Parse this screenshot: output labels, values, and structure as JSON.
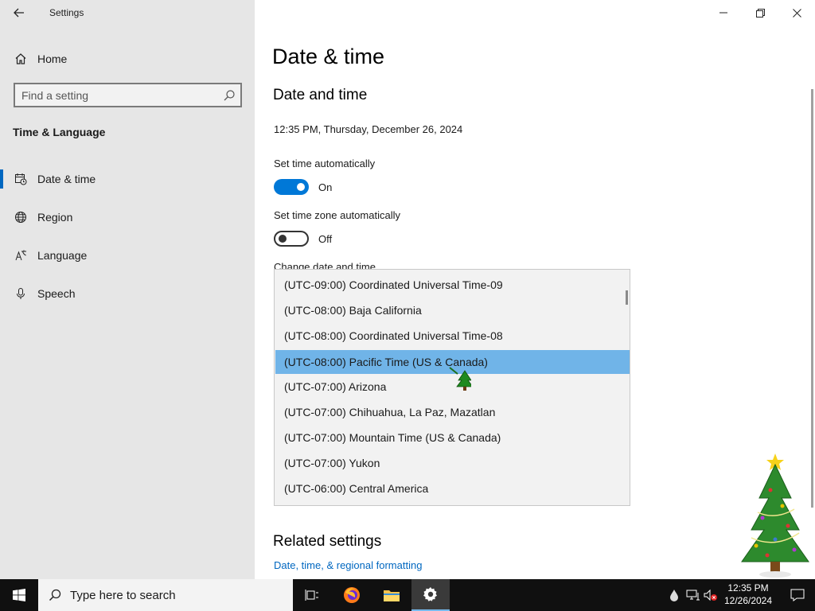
{
  "window": {
    "app_title": "Settings"
  },
  "sidebar": {
    "home_label": "Home",
    "search_placeholder": "Find a setting",
    "section_heading": "Time & Language",
    "items": [
      {
        "label": "Date & time",
        "icon": "calendar-clock-icon",
        "active": true
      },
      {
        "label": "Region",
        "icon": "globe-icon",
        "active": false
      },
      {
        "label": "Language",
        "icon": "language-icon",
        "active": false
      },
      {
        "label": "Speech",
        "icon": "microphone-icon",
        "active": false
      }
    ]
  },
  "main": {
    "page_title": "Date & time",
    "section_title": "Date and time",
    "current_datetime": "12:35 PM, Thursday, December 26, 2024",
    "set_time_auto": {
      "label": "Set time automatically",
      "state": "On",
      "on": true
    },
    "set_zone_auto": {
      "label": "Set time zone automatically",
      "state": "Off",
      "on": false
    },
    "change_label": "Change date and time",
    "timezone_options": [
      "(UTC-09:00) Coordinated Universal Time-09",
      "(UTC-08:00) Baja California",
      "(UTC-08:00) Coordinated Universal Time-08",
      "(UTC-08:00) Pacific Time (US & Canada)",
      "(UTC-07:00) Arizona",
      "(UTC-07:00) Chihuahua, La Paz, Mazatlan",
      "(UTC-07:00) Mountain Time (US & Canada)",
      "(UTC-07:00) Yukon",
      "(UTC-06:00) Central America"
    ],
    "selected_timezone_index": 3,
    "related_title": "Related settings",
    "related_link": "Date, time, & regional formatting"
  },
  "taskbar": {
    "search_placeholder": "Type here to search",
    "apps": [
      "task-view-icon",
      "firefox-icon",
      "file-explorer-icon",
      "settings-icon"
    ],
    "active_app": "settings-icon",
    "clock_time": "12:35 PM",
    "clock_date": "12/26/2024"
  },
  "colors": {
    "accent": "#0078d7",
    "selection": "#70b4e8",
    "sidebar_bg": "#e6e6e6",
    "link": "#0067c0",
    "taskbar_bg": "#101010"
  }
}
